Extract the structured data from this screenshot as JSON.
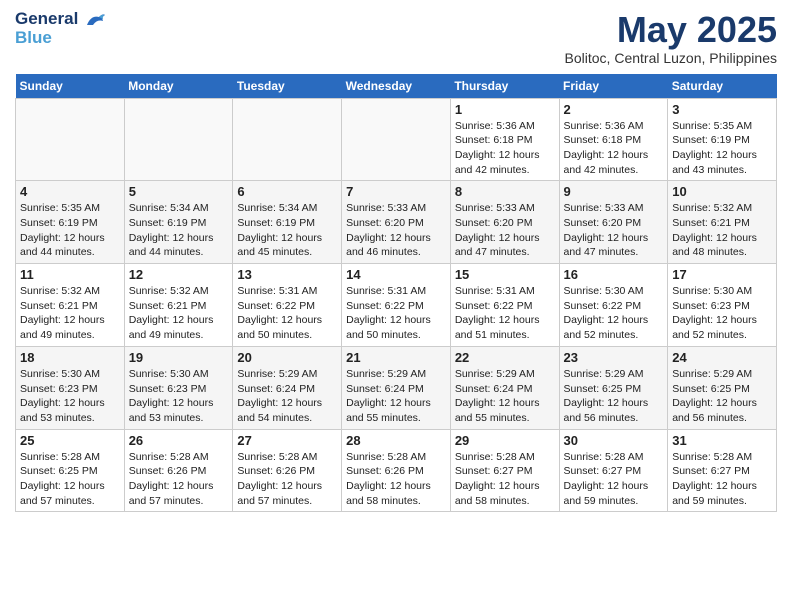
{
  "header": {
    "logo_line1": "General",
    "logo_line2": "Blue",
    "month": "May 2025",
    "location": "Bolitoc, Central Luzon, Philippines"
  },
  "days_of_week": [
    "Sunday",
    "Monday",
    "Tuesday",
    "Wednesday",
    "Thursday",
    "Friday",
    "Saturday"
  ],
  "weeks": [
    [
      {
        "day": "",
        "info": ""
      },
      {
        "day": "",
        "info": ""
      },
      {
        "day": "",
        "info": ""
      },
      {
        "day": "",
        "info": ""
      },
      {
        "day": "1",
        "info": "Sunrise: 5:36 AM\nSunset: 6:18 PM\nDaylight: 12 hours\nand 42 minutes."
      },
      {
        "day": "2",
        "info": "Sunrise: 5:36 AM\nSunset: 6:18 PM\nDaylight: 12 hours\nand 42 minutes."
      },
      {
        "day": "3",
        "info": "Sunrise: 5:35 AM\nSunset: 6:19 PM\nDaylight: 12 hours\nand 43 minutes."
      }
    ],
    [
      {
        "day": "4",
        "info": "Sunrise: 5:35 AM\nSunset: 6:19 PM\nDaylight: 12 hours\nand 44 minutes."
      },
      {
        "day": "5",
        "info": "Sunrise: 5:34 AM\nSunset: 6:19 PM\nDaylight: 12 hours\nand 44 minutes."
      },
      {
        "day": "6",
        "info": "Sunrise: 5:34 AM\nSunset: 6:19 PM\nDaylight: 12 hours\nand 45 minutes."
      },
      {
        "day": "7",
        "info": "Sunrise: 5:33 AM\nSunset: 6:20 PM\nDaylight: 12 hours\nand 46 minutes."
      },
      {
        "day": "8",
        "info": "Sunrise: 5:33 AM\nSunset: 6:20 PM\nDaylight: 12 hours\nand 47 minutes."
      },
      {
        "day": "9",
        "info": "Sunrise: 5:33 AM\nSunset: 6:20 PM\nDaylight: 12 hours\nand 47 minutes."
      },
      {
        "day": "10",
        "info": "Sunrise: 5:32 AM\nSunset: 6:21 PM\nDaylight: 12 hours\nand 48 minutes."
      }
    ],
    [
      {
        "day": "11",
        "info": "Sunrise: 5:32 AM\nSunset: 6:21 PM\nDaylight: 12 hours\nand 49 minutes."
      },
      {
        "day": "12",
        "info": "Sunrise: 5:32 AM\nSunset: 6:21 PM\nDaylight: 12 hours\nand 49 minutes."
      },
      {
        "day": "13",
        "info": "Sunrise: 5:31 AM\nSunset: 6:22 PM\nDaylight: 12 hours\nand 50 minutes."
      },
      {
        "day": "14",
        "info": "Sunrise: 5:31 AM\nSunset: 6:22 PM\nDaylight: 12 hours\nand 50 minutes."
      },
      {
        "day": "15",
        "info": "Sunrise: 5:31 AM\nSunset: 6:22 PM\nDaylight: 12 hours\nand 51 minutes."
      },
      {
        "day": "16",
        "info": "Sunrise: 5:30 AM\nSunset: 6:22 PM\nDaylight: 12 hours\nand 52 minutes."
      },
      {
        "day": "17",
        "info": "Sunrise: 5:30 AM\nSunset: 6:23 PM\nDaylight: 12 hours\nand 52 minutes."
      }
    ],
    [
      {
        "day": "18",
        "info": "Sunrise: 5:30 AM\nSunset: 6:23 PM\nDaylight: 12 hours\nand 53 minutes."
      },
      {
        "day": "19",
        "info": "Sunrise: 5:30 AM\nSunset: 6:23 PM\nDaylight: 12 hours\nand 53 minutes."
      },
      {
        "day": "20",
        "info": "Sunrise: 5:29 AM\nSunset: 6:24 PM\nDaylight: 12 hours\nand 54 minutes."
      },
      {
        "day": "21",
        "info": "Sunrise: 5:29 AM\nSunset: 6:24 PM\nDaylight: 12 hours\nand 55 minutes."
      },
      {
        "day": "22",
        "info": "Sunrise: 5:29 AM\nSunset: 6:24 PM\nDaylight: 12 hours\nand 55 minutes."
      },
      {
        "day": "23",
        "info": "Sunrise: 5:29 AM\nSunset: 6:25 PM\nDaylight: 12 hours\nand 56 minutes."
      },
      {
        "day": "24",
        "info": "Sunrise: 5:29 AM\nSunset: 6:25 PM\nDaylight: 12 hours\nand 56 minutes."
      }
    ],
    [
      {
        "day": "25",
        "info": "Sunrise: 5:28 AM\nSunset: 6:25 PM\nDaylight: 12 hours\nand 57 minutes."
      },
      {
        "day": "26",
        "info": "Sunrise: 5:28 AM\nSunset: 6:26 PM\nDaylight: 12 hours\nand 57 minutes."
      },
      {
        "day": "27",
        "info": "Sunrise: 5:28 AM\nSunset: 6:26 PM\nDaylight: 12 hours\nand 57 minutes."
      },
      {
        "day": "28",
        "info": "Sunrise: 5:28 AM\nSunset: 6:26 PM\nDaylight: 12 hours\nand 58 minutes."
      },
      {
        "day": "29",
        "info": "Sunrise: 5:28 AM\nSunset: 6:27 PM\nDaylight: 12 hours\nand 58 minutes."
      },
      {
        "day": "30",
        "info": "Sunrise: 5:28 AM\nSunset: 6:27 PM\nDaylight: 12 hours\nand 59 minutes."
      },
      {
        "day": "31",
        "info": "Sunrise: 5:28 AM\nSunset: 6:27 PM\nDaylight: 12 hours\nand 59 minutes."
      }
    ]
  ]
}
